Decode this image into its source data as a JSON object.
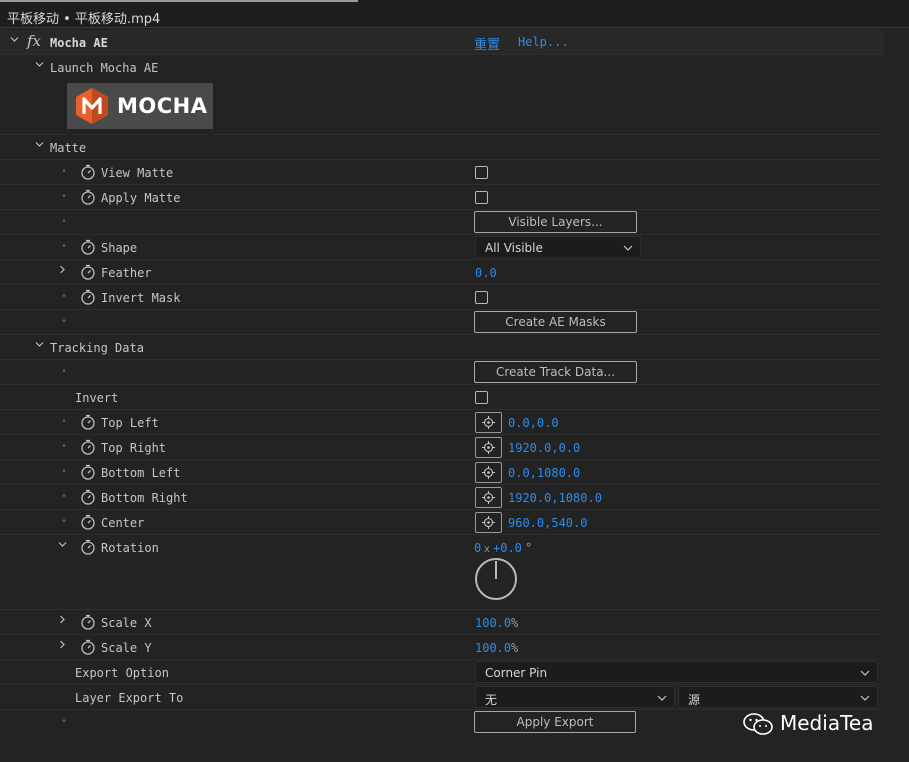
{
  "window": {
    "title": "平板移动 • 平板移动.mp4"
  },
  "effect": {
    "name": "Mocha AE",
    "reset_label": "重置",
    "help_label": "Help...",
    "fx_glyph": "fx"
  },
  "launch": {
    "label": "Launch Mocha AE",
    "logo_text": "MOCHA"
  },
  "matte": {
    "label": "Matte",
    "view_matte": "View Matte",
    "apply_matte": "Apply Matte",
    "visible_layers_button": "Visible Layers...",
    "shape_label": "Shape",
    "shape_value": "All Visible",
    "feather_label": "Feather",
    "feather_value": "0.0",
    "invert_mask_label": "Invert Mask",
    "create_masks_button": "Create AE Masks"
  },
  "tracking": {
    "label": "Tracking Data",
    "create_track_button": "Create Track Data...",
    "invert_label": "Invert",
    "top_left_label": "Top Left",
    "top_left_value": "0.0,0.0",
    "top_right_label": "Top Right",
    "top_right_value": "1920.0,0.0",
    "bottom_left_label": "Bottom Left",
    "bottom_left_value": "0.0,1080.0",
    "bottom_right_label": "Bottom Right",
    "bottom_right_value": "1920.0,1080.0",
    "center_label": "Center",
    "center_value": "960.0,540.0",
    "rotation_label": "Rotation",
    "rotation_turns": "0",
    "rotation_x": "x",
    "rotation_degrees": "+0.0",
    "rotation_unit": "°",
    "scale_x_label": "Scale X",
    "scale_x_value": "100.0",
    "scale_y_label": "Scale Y",
    "scale_y_value": "100.0",
    "percent": "%",
    "export_option_label": "Export Option",
    "export_option_value": "Corner Pin",
    "layer_export_label": "Layer Export To",
    "layer_export_value": "无",
    "layer_source_value": "源",
    "apply_export_button": "Apply Export"
  },
  "watermark": {
    "text": "MediaTea",
    "icon": "wechat-icon"
  },
  "colors": {
    "accent": "#2d8ceb",
    "background": "#232323",
    "logo_orange": "#e8612c"
  }
}
